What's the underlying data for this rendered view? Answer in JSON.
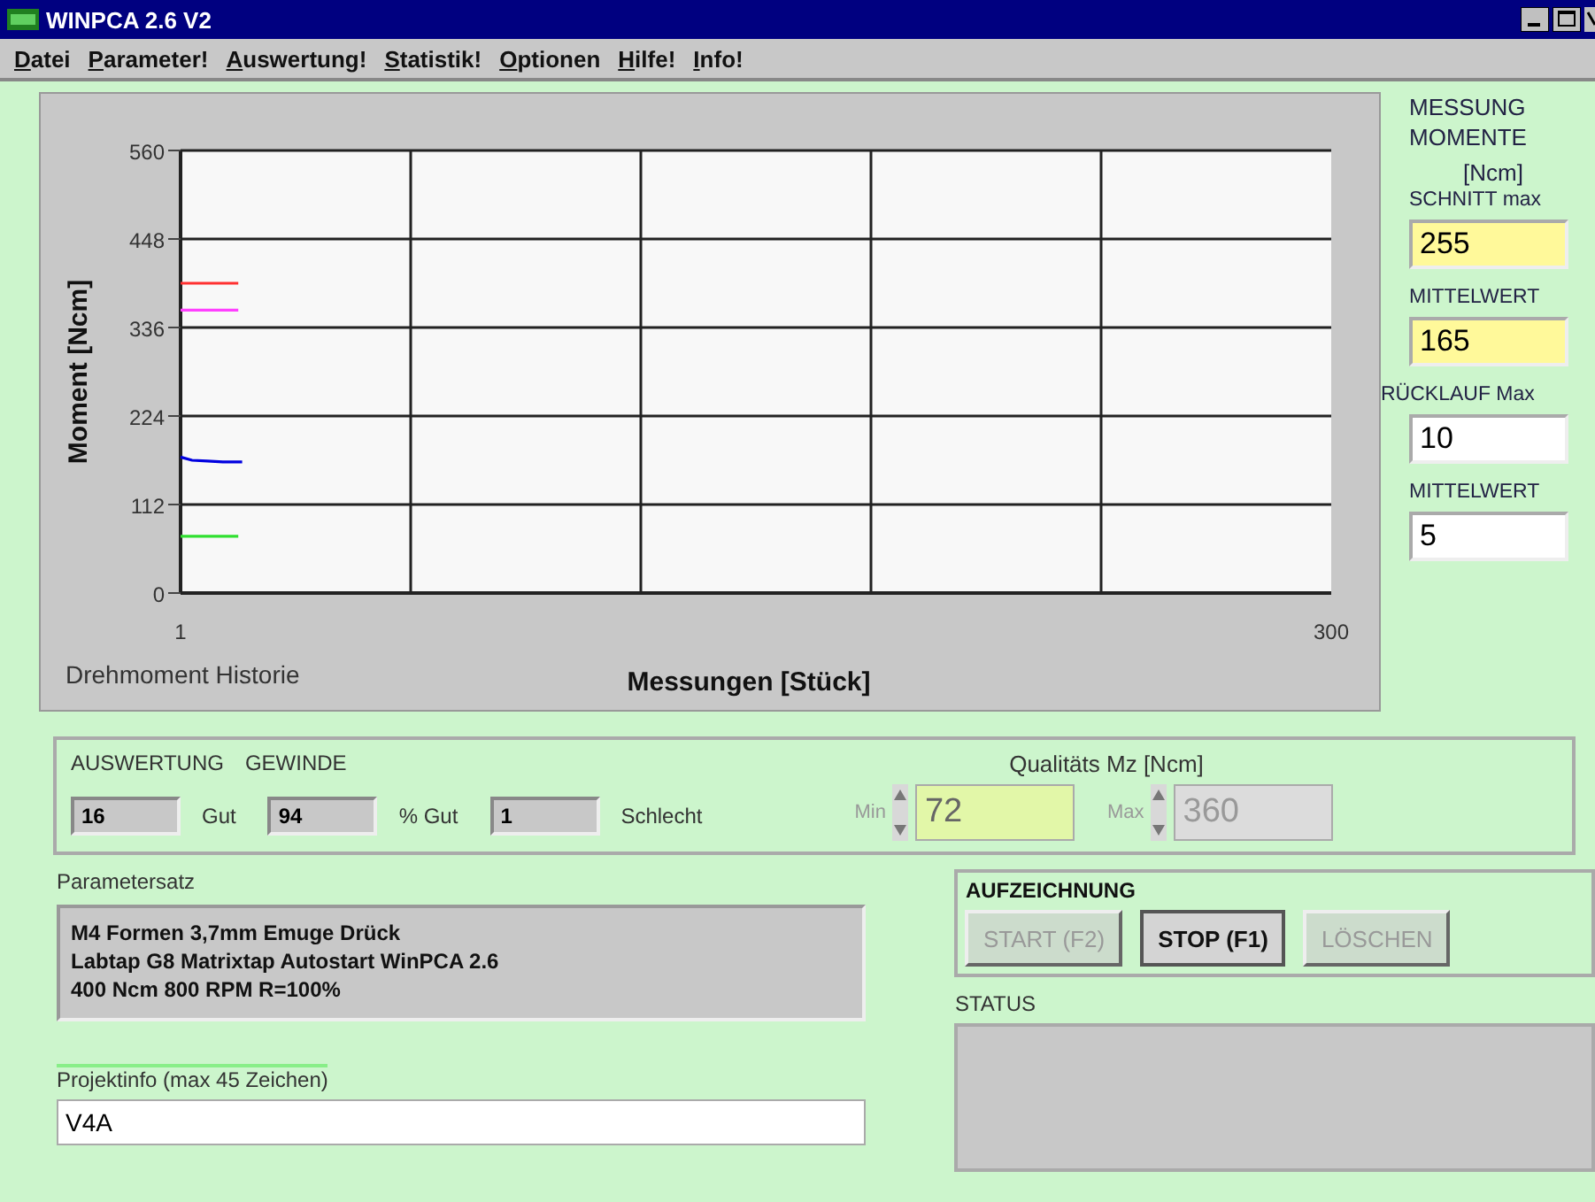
{
  "window": {
    "title": "WINPCA 2.6 V2"
  },
  "menu": [
    "Datei",
    "Parameter!",
    "Auswertung!",
    "Statistik!",
    "Optionen",
    "Hilfe!",
    "Info!"
  ],
  "chart": {
    "title": "Drehmoment Historie",
    "chart_data": {
      "type": "line",
      "xlabel": "Messungen [Stück]",
      "ylabel": "Moment [Ncm]",
      "xlim": [
        1,
        300
      ],
      "ylim": [
        0,
        560
      ],
      "xticks": [
        1,
        300
      ],
      "yticks": [
        0,
        112,
        224,
        336,
        448,
        560
      ],
      "grid": true,
      "series": [
        {
          "color": "#ff3030",
          "x": [
            1,
            16
          ],
          "values": [
            392,
            392
          ]
        },
        {
          "color": "#ff40ff",
          "x": [
            1,
            16
          ],
          "values": [
            358,
            358
          ]
        },
        {
          "color": "#0000e0",
          "x": [
            1,
            4,
            8,
            12,
            17
          ],
          "values": [
            172,
            168,
            167,
            166,
            166
          ]
        },
        {
          "color": "#30e030",
          "x": [
            1,
            16
          ],
          "values": [
            72,
            72
          ]
        }
      ]
    }
  },
  "measurement": {
    "heading_1": "MESSUNG",
    "heading_2": "MOMENTE",
    "unit": "[Ncm]",
    "fields": [
      {
        "label": "SCHNITT max",
        "value": "255",
        "kind": "highlight"
      },
      {
        "label": "MITTELWERT",
        "value": "165",
        "kind": "highlight"
      },
      {
        "label": "RÜCKLAUF Max",
        "value": "10",
        "kind": "plain"
      },
      {
        "label": "MITTELWERT",
        "value": "5",
        "kind": "plain"
      }
    ]
  },
  "evaluation": {
    "label_1": "AUSWERTUNG",
    "label_2": "GEWINDE",
    "good": "16",
    "good_label": "Gut",
    "percent": "94",
    "percent_label": "% Gut",
    "bad": "1",
    "bad_label": "Schlecht",
    "quality_title": "Qualitäts Mz [Ncm]",
    "min_label": "Min",
    "min": "72",
    "min_disabled": false,
    "max_label": "Max",
    "max": "360",
    "max_disabled": true
  },
  "parameter_set": {
    "label": "Parametersatz",
    "lines": [
      "M4 Formen 3,7mm Emuge Drück",
      "Labtap G8 Matrixtap Autostart WinPCA 2.6",
      "400 Ncm  800 RPM  R=100%"
    ]
  },
  "project_info": {
    "label": "Projektinfo (max 45 Zeichen)",
    "value": "V4A"
  },
  "recording": {
    "title": "AUFZEICHNUNG",
    "buttons": [
      {
        "label": "START (F2)",
        "disabled": true
      },
      {
        "label": "STOP (F1)",
        "disabled": false
      },
      {
        "label": "LÖSCHEN",
        "disabled": true
      }
    ]
  },
  "status": {
    "label": "STATUS"
  }
}
